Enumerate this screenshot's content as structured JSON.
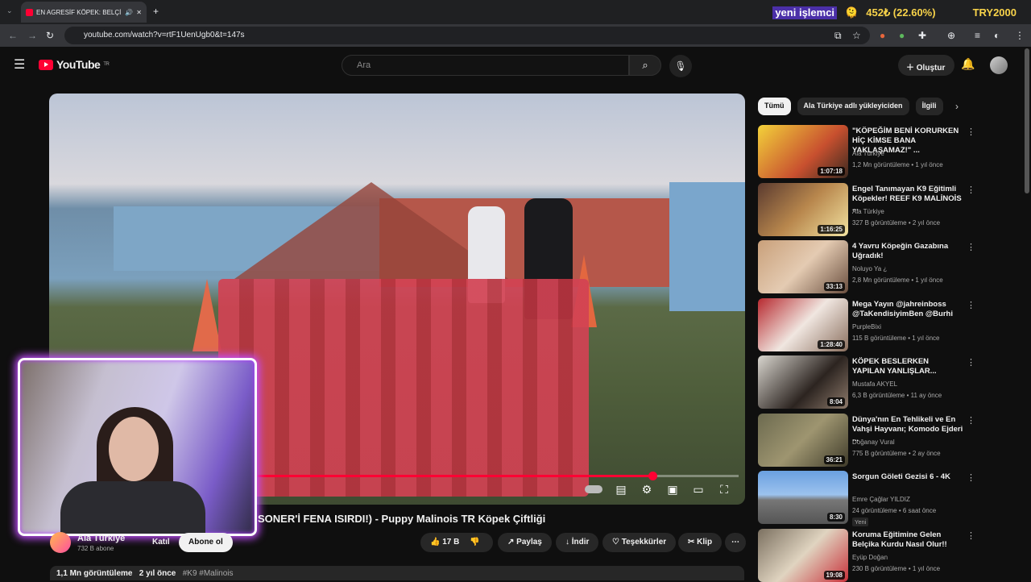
{
  "browser": {
    "tab_title": "EN AGRESİF KÖPEK: BELÇİKA",
    "url": "youtube.com/watch?v=rtF1UenUgb0&t=147s",
    "new_tab": "+"
  },
  "overlay": {
    "brand": "yeni işlemci",
    "emoji": "🫠",
    "value": "452₺ (22.60%)",
    "ticker": "TRY2000"
  },
  "header": {
    "logo": "YouTube",
    "region": "TR",
    "search_placeholder": "Ara",
    "create_label": "Oluştur"
  },
  "player": {
    "progress": 0.82
  },
  "video": {
    "title": "SONER'İ FENA ISIRDI!) - Puppy Malinois TR Köpek Çiftliği",
    "channel": "Ala Türkiye",
    "subscribers": "732 B abone",
    "join": "Katıl",
    "subscribe": "Abone ol",
    "likes": "17 B",
    "share": "Paylaş",
    "download": "İndir",
    "thanks": "Teşekkürler",
    "clip": "Klip",
    "views": "1,1 Mn görüntüleme",
    "age": "2 yıl önce",
    "tags": "#K9 #Malinois"
  },
  "sidebar": {
    "chips": [
      "Tümü",
      "Ala Türkiye adlı yükleyiciden",
      "İlgili"
    ],
    "items": [
      {
        "title": "\"KÖPEĞİM BENİ KORURKEN HİÇ KİMSE BANA YAKLAŞAMAZ!\" ...",
        "channel": "Ala Türkiye",
        "meta": "1,2 Mn görüntüleme • 1 yıl önce",
        "duration": "1:07:18",
        "badge": ""
      },
      {
        "title": "Engel Tanımayan K9 Eğitimli Köpekler! REEF K9 MALİNOİS ...",
        "channel": "Ala Türkiye",
        "meta": "327 B görüntüleme • 2 yıl önce",
        "duration": "1:16:25",
        "badge": ""
      },
      {
        "title": "4 Yavru Köpeğin Gazabına Uğradık!",
        "channel": "Noluyo Ya ¿",
        "meta": "2,8 Mn görüntüleme • 1 yıl önce",
        "duration": "33:13",
        "badge": ""
      },
      {
        "title": "Mega Yayın @jahreinboss @TaKendisiyimBen @Burhi",
        "channel": "PurpleBixi",
        "meta": "115 B görüntüleme • 1 yıl önce",
        "duration": "1:28:40",
        "badge": ""
      },
      {
        "title": "KÖPEK BESLERKEN YAPILAN YANLIŞLAR...",
        "channel": "Mustafa AKYEL",
        "meta": "6,3 B görüntüleme • 11 ay önce",
        "duration": "8:04",
        "badge": ""
      },
      {
        "title": "Dünya'nın En Tehlikeli ve En Vahşi Hayvanı; Komodo Ejderi ...",
        "channel": "Doğanay Vural",
        "meta": "775 B görüntüleme • 2 ay önce",
        "duration": "36:21",
        "badge": ""
      },
      {
        "title": "Sorgun Göleti Gezisi 6 - 4K",
        "channel": "Emre Çağlar YILDIZ",
        "meta": "24 görüntüleme • 6 saat önce",
        "duration": "8:30",
        "badge": "Yeni"
      },
      {
        "title": "Koruma Eğitimine Gelen Belçika Kurdu Nasıl Olur!!",
        "channel": "Eyüp Doğan",
        "meta": "230 B görüntüleme • 1 yıl önce",
        "duration": "19:08",
        "badge": ""
      }
    ]
  },
  "colors": {
    "accent": "#ff0033",
    "cam_glow": "#c34dff"
  }
}
